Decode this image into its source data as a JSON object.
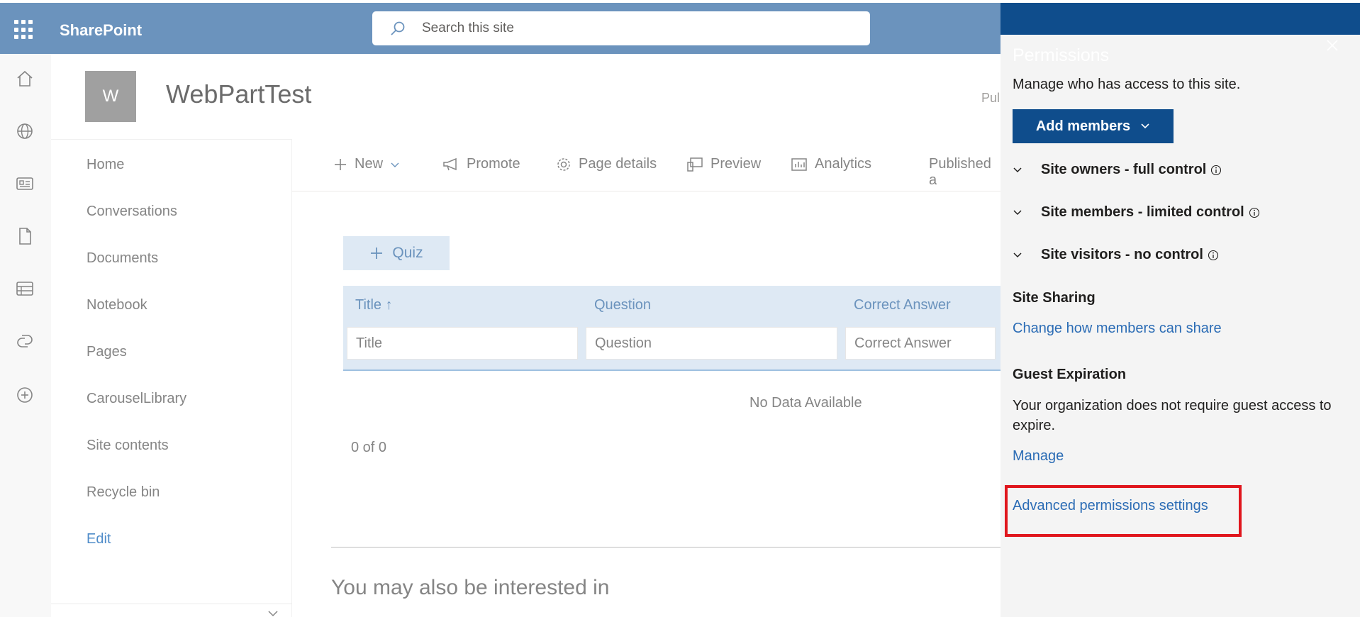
{
  "suite": {
    "brand": "SharePoint",
    "search_placeholder": "Search this site"
  },
  "appbar": {
    "icons": [
      "home-icon",
      "globe-icon",
      "news-icon",
      "document-icon",
      "list-icon",
      "copilot-icon",
      "add-icon"
    ]
  },
  "site": {
    "logo_letter": "W",
    "title": "WebPartTest",
    "published_tag": "Pul"
  },
  "nav": {
    "items": [
      "Home",
      "Conversations",
      "Documents",
      "Notebook",
      "Pages",
      "CarouselLibrary",
      "Site contents",
      "Recycle bin"
    ],
    "edit_label": "Edit"
  },
  "commandbar": {
    "new": "New",
    "promote": "Promote",
    "page_details": "Page details",
    "preview": "Preview",
    "analytics": "Analytics",
    "published": "Published a"
  },
  "quiz": {
    "add_label": "Quiz",
    "columns": [
      "Title",
      "Question",
      "Correct Answer"
    ],
    "sort_indicator": "↑",
    "filter_placeholders": [
      "Title",
      "Question",
      "Correct Answer"
    ],
    "empty_message": "No Data Available",
    "paging": "0 of 0"
  },
  "related": {
    "heading": "You may also be interested in"
  },
  "panel": {
    "title": "Permissions",
    "description": "Manage who has access to this site.",
    "add_members": "Add members",
    "groups": [
      "Site owners - full control",
      "Site members - limited control",
      "Site visitors - no control"
    ],
    "site_sharing_heading": "Site Sharing",
    "site_sharing_link": "Change how members can share",
    "guest_heading": "Guest Expiration",
    "guest_text": "Your organization does not require guest access to expire.",
    "guest_manage": "Manage",
    "advanced_link": "Advanced permissions settings",
    "highlight_color": "#e0161d"
  },
  "colors": {
    "suite_bar": "#6b93bd",
    "panel_header": "#0f4d8c",
    "link": "#2b6cb5"
  }
}
